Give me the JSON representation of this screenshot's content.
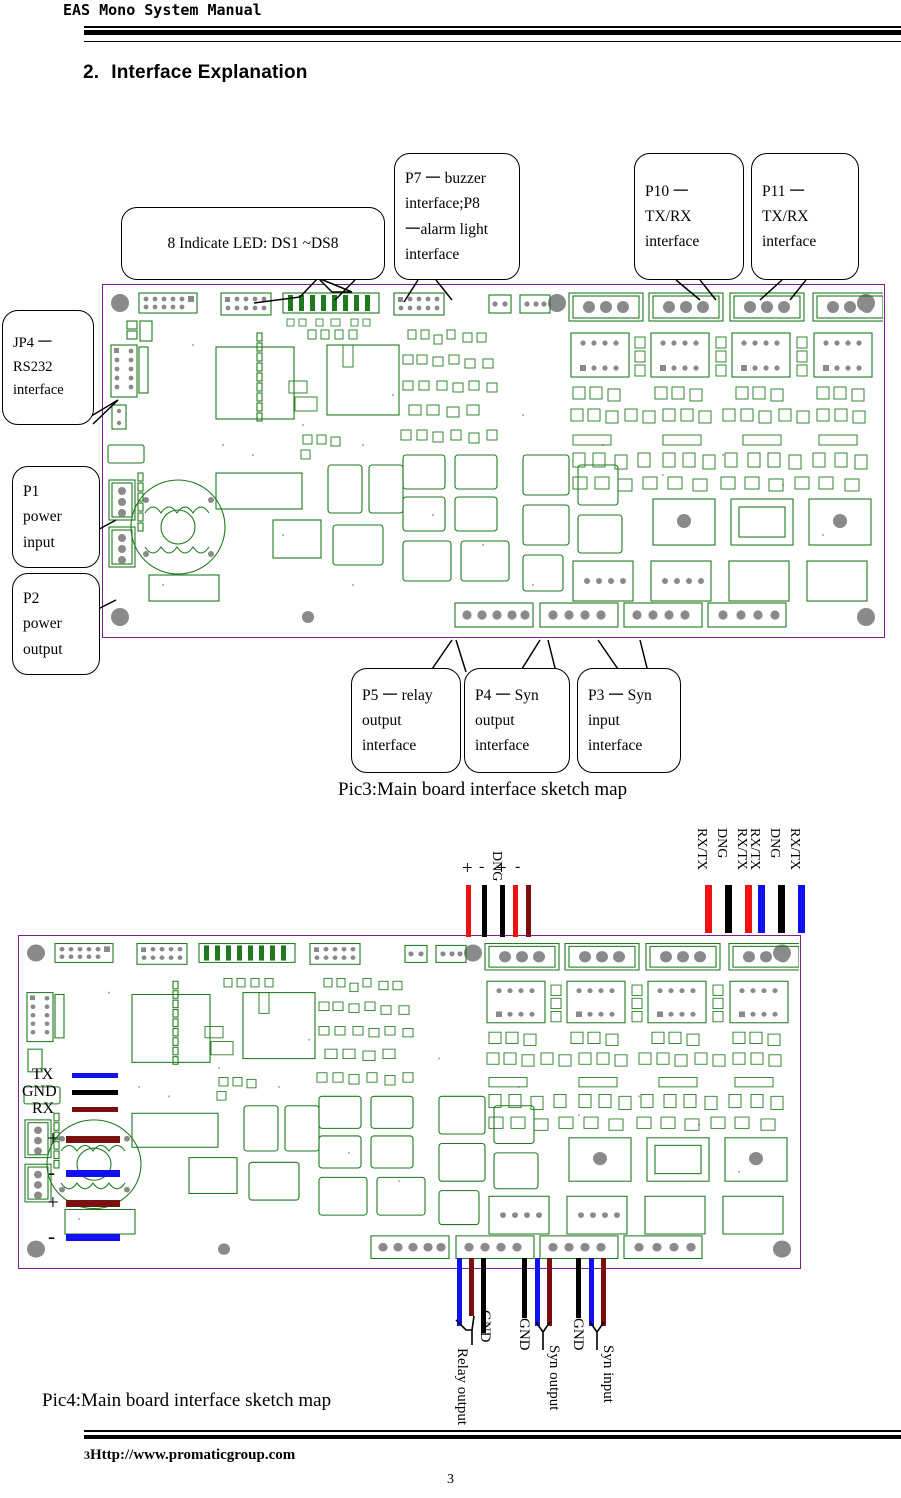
{
  "header": {
    "title": "EAS Mono System Manual"
  },
  "section": {
    "number": "2.",
    "title": "Interface Explanation"
  },
  "pic3": {
    "caption": "Pic3:Main board interface sketch map",
    "callouts": {
      "led": {
        "lines": [
          "8 Indicate LED: DS1 ~DS8"
        ]
      },
      "p7p8": {
        "lines": [
          "P7 一 buzzer",
          "interface;P8",
          "一alarm light",
          "interface"
        ]
      },
      "p10": {
        "lines": [
          "P10     一",
          "TX/RX",
          "interface"
        ]
      },
      "p11": {
        "lines": [
          "P11    一",
          "TX/RX",
          "interface"
        ]
      },
      "jp4": {
        "lines": [
          "JP4      一",
          "RS232",
          "interface"
        ]
      },
      "p1": {
        "lines": [
          "P1",
          "power",
          "input"
        ]
      },
      "p2": {
        "lines": [
          "P2",
          "power",
          "output"
        ]
      },
      "p5": {
        "lines": [
          "P5 一 relay",
          "output",
          "interface"
        ]
      },
      "p4": {
        "lines": [
          "P4 一 Syn",
          "output",
          "interface"
        ]
      },
      "p3": {
        "lines": [
          "P3 一 Syn",
          "input",
          "interface"
        ]
      }
    }
  },
  "pic4": {
    "caption": "Pic4:Main board interface sketch map",
    "top_labels": {
      "grp1": [
        "+",
        "-"
      ],
      "grp2": [
        "D",
        "N",
        "G"
      ],
      "grp2_text": "DNG",
      "grp3": [
        "+",
        "-"
      ],
      "red_bus": [
        "RX/TX",
        "DNG",
        "RX/TX"
      ],
      "blue_bus": [
        "RX/TX",
        "DNG",
        "RX/TX"
      ]
    },
    "left_labels": {
      "serial": [
        "TX",
        "GND",
        "RX"
      ],
      "power_in": [
        "+",
        "-"
      ],
      "power_out": [
        "+",
        "-"
      ]
    },
    "bottom_labels": {
      "relay": {
        "gnd": "GND",
        "name": "Relay output"
      },
      "syn_out": {
        "gnd": "GND",
        "name": "Syn output"
      },
      "syn_in": {
        "gnd": "GND",
        "name": "Syn input"
      }
    }
  },
  "footer": {
    "prefix": "3",
    "url": "Http://www.promaticgroup.com",
    "page": "3"
  },
  "colors": {
    "pcb_outline": "#7d1f8e",
    "silkscreen": "#1f7a1f",
    "pad": "#808080",
    "wire_red": "#7a0f0f",
    "wire_bright_red": "#ee1111",
    "wire_blue": "#1111ee",
    "wire_black": "#000000"
  }
}
